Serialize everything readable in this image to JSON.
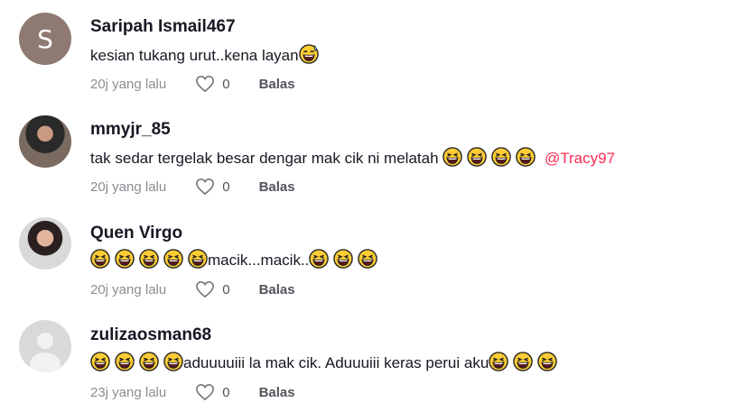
{
  "comments": [
    {
      "username": "Saripah Ismail467",
      "avatar_letter": "S",
      "text": "kesian tukang urut..kena layan",
      "time": "20j yang lalu",
      "likes": "0",
      "reply": "Balas"
    },
    {
      "username": "mmyjr_85",
      "text": "tak sedar tergelak besar dengar mak cik ni melatah",
      "mention": "@Tracy97",
      "time": "20j yang lalu",
      "likes": "0",
      "reply": "Balas"
    },
    {
      "username": "Quen Virgo",
      "text": "macik...macik..",
      "time": "20j yang lalu",
      "likes": "0",
      "reply": "Balas"
    },
    {
      "username": "zulizaosman68",
      "text": "aduuuuiii la mak cik. Aduuuiii keras perui aku",
      "time": "23j yang lalu",
      "likes": "0",
      "reply": "Balas"
    }
  ],
  "icons": {
    "emoji": "grinning-squinting-face-icon",
    "emoji_sweat": "grinning-sweat-face-icon",
    "like": "heart-outline-icon"
  },
  "colors": {
    "mention": "#fe2c55",
    "text": "#161823"
  }
}
